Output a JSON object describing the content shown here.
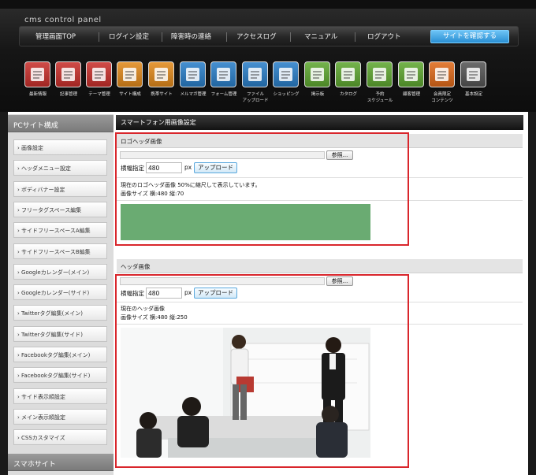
{
  "app": {
    "brand": "cms control panel"
  },
  "nav": {
    "items": [
      "管理画面TOP",
      "ログイン設定",
      "障害時の連絡",
      "アクセスログ",
      "マニュアル",
      "ログアウト"
    ],
    "site_button": "サイトを確認する"
  },
  "toolbar": {
    "items": [
      {
        "label": "最新情報",
        "icon": "news-icon",
        "color": "#c9302c"
      },
      {
        "label": "記事管理",
        "icon": "articles-icon",
        "color": "#c9302c"
      },
      {
        "label": "テーマ管理",
        "icon": "theme-list-icon",
        "color": "#c9302c"
      },
      {
        "label": "サイト構成",
        "icon": "site-layout-icon",
        "color": "#e28a1c"
      },
      {
        "label": "携帯サイト",
        "icon": "mobile-site-icon",
        "color": "#e28a1c"
      },
      {
        "label": "メルマガ管理",
        "icon": "mail-magazine-icon",
        "color": "#2a7fc9"
      },
      {
        "label": "フォーム管理",
        "icon": "form-icon",
        "color": "#2a7fc9"
      },
      {
        "label": "ファイル\nアップロード",
        "icon": "file-upload-icon",
        "color": "#2a7fc9"
      },
      {
        "label": "ショッピング",
        "icon": "shopping-cart-icon",
        "color": "#2a7fc9"
      },
      {
        "label": "掲示板",
        "icon": "bulletin-board-icon",
        "color": "#5fa831"
      },
      {
        "label": "カタログ",
        "icon": "catalog-icon",
        "color": "#5fa831"
      },
      {
        "label": "予約\nスケジュール",
        "icon": "schedule-icon",
        "color": "#5fa831"
      },
      {
        "label": "顧客管理",
        "icon": "customer-icon",
        "color": "#5fa831"
      },
      {
        "label": "会員限定\nコンテンツ",
        "icon": "members-lock-icon",
        "color": "#e06a1a"
      },
      {
        "label": "基本設定",
        "icon": "gear-icon",
        "color": "#555555"
      }
    ]
  },
  "sidebar": {
    "pc_heading": "PCサイト構成",
    "items": [
      "画像設定",
      "ヘッダメニュー設定",
      "ボディバナー設定",
      "フリータグスペース編集",
      "サイドフリースペースA編集",
      "サイドフリースペースB編集",
      "Googleカレンダー(メイン)",
      "Googleカレンダー(サイド)",
      "Twitterタグ編集(メイン)",
      "Twitterタグ編集(サイド)",
      "Facebookタグ編集(メイン)",
      "Facebookタグ編集(サイド)",
      "サイド表示順設定",
      "メイン表示順設定",
      "CSSカスタマイズ"
    ],
    "sp_heading": "スマホサイト"
  },
  "main": {
    "page_title": "スマートフォン用画像設定",
    "logo_section": {
      "heading": "ロゴヘッダ画像",
      "browse_label": "参照...",
      "width_label": "横幅指定",
      "width_value": "480",
      "unit": "px",
      "upload_label": "アップロード",
      "current_text": "現在のロゴヘッダ画像  50%に縮尺して表示しています。",
      "size_text": "画像サイズ  横:480 縦:70",
      "preview_color": "#6aab72"
    },
    "header_section": {
      "heading": "ヘッダ画像",
      "browse_label": "参照...",
      "width_label": "横幅指定",
      "width_value": "480",
      "unit": "px",
      "upload_label": "アップロード",
      "current_text": "現在のヘッダ画像",
      "size_text": "画像サイズ  横:480 縦:250"
    }
  },
  "colors": {
    "highlight": "#d9262c",
    "accent": "#2a8fd3"
  }
}
